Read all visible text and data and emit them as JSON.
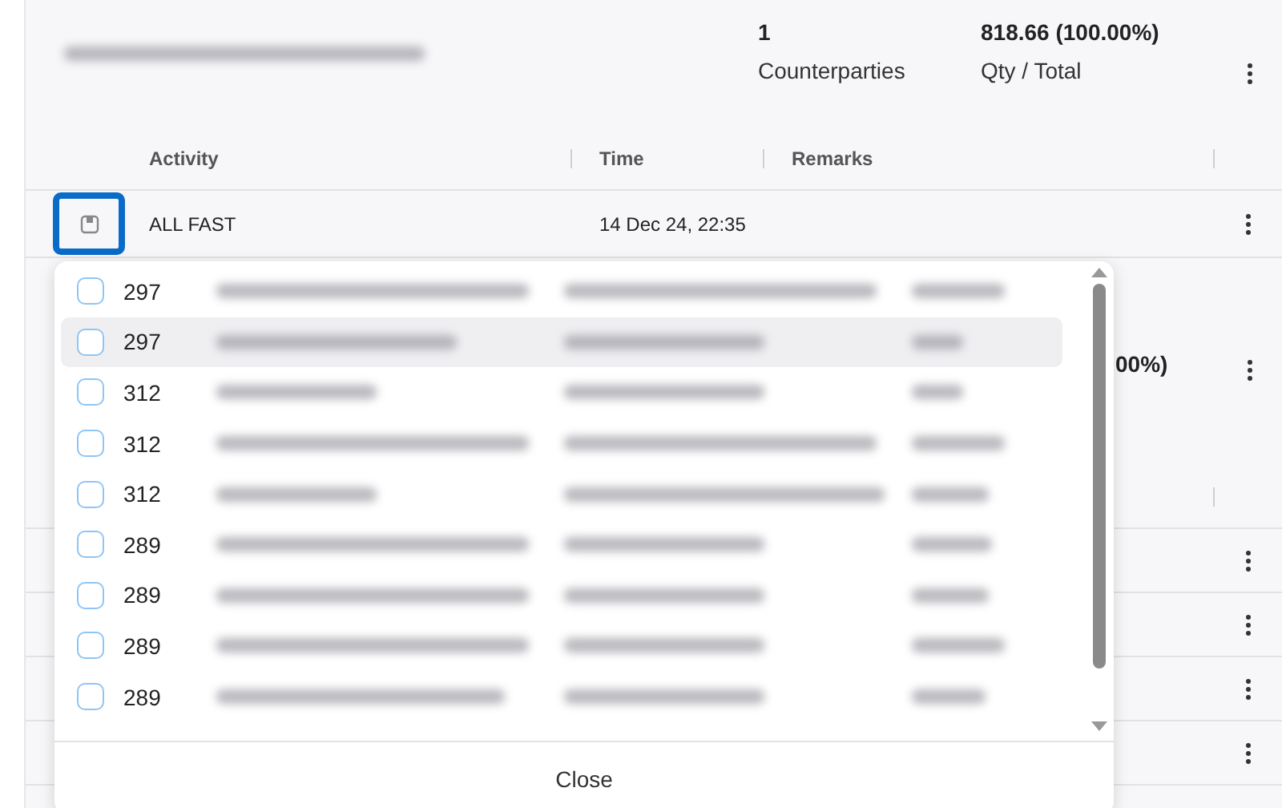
{
  "summary": {
    "counterparties_value": "1",
    "counterparties_label": "Counterparties",
    "qty_value": "818.66 (100.00%)",
    "qty_label": "Qty / Total"
  },
  "activity_table": {
    "columns": [
      "Activity",
      "Time",
      "Remarks"
    ],
    "rows": [
      {
        "activity": "ALL FAST",
        "time": "14 Dec 24, 22:35",
        "selected": true
      }
    ]
  },
  "second_summary": {
    "qty_value": "00%)"
  },
  "picker": {
    "items": [
      {
        "number": "297",
        "checked": false,
        "highlighted": false
      },
      {
        "number": "297",
        "checked": false,
        "highlighted": true
      },
      {
        "number": "312",
        "checked": false,
        "highlighted": false
      },
      {
        "number": "312",
        "checked": false,
        "highlighted": false
      },
      {
        "number": "312",
        "checked": false,
        "highlighted": false
      },
      {
        "number": "289",
        "checked": false,
        "highlighted": false
      },
      {
        "number": "289",
        "checked": false,
        "highlighted": false
      },
      {
        "number": "289",
        "checked": false,
        "highlighted": false
      },
      {
        "number": "289",
        "checked": false,
        "highlighted": false
      }
    ],
    "close_label": "Close"
  }
}
